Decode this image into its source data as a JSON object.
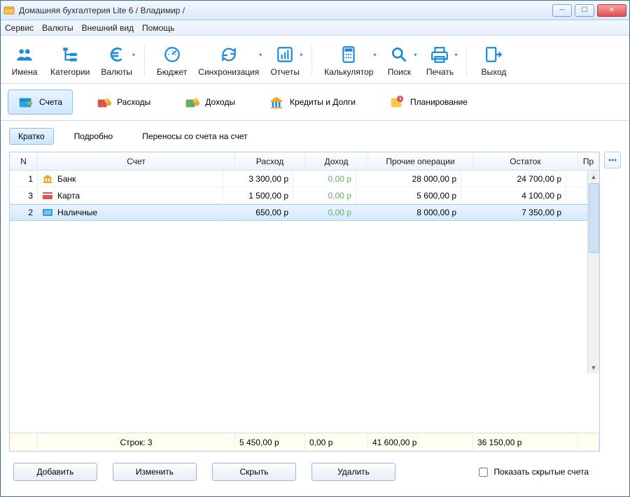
{
  "window": {
    "title": "Домашняя бухгалтерия Lite 6  / Владимир /"
  },
  "menu": {
    "service": "Сервис",
    "currencies": "Валюты",
    "view": "Внешний вид",
    "help": "Помощь"
  },
  "toolbar": {
    "names": "Имена",
    "categories": "Категории",
    "currencies": "Валюты",
    "budget": "Бюджет",
    "sync": "Синхронизация",
    "reports": "Отчеты",
    "calculator": "Калькулятор",
    "search": "Поиск",
    "print": "Печать",
    "exit": "Выход"
  },
  "sections": {
    "accounts": "Счета",
    "expenses": "Расходы",
    "income": "Доходы",
    "loans": "Кредиты и Долги",
    "planning": "Планирование"
  },
  "subtabs": {
    "brief": "Кратко",
    "detail": "Подробно",
    "transfers": "Переносы со счета на счет"
  },
  "grid": {
    "headers": {
      "n": "N",
      "account": "Счет",
      "expense": "Расход",
      "income": "Доход",
      "other": "Прочие операции",
      "balance": "Остаток",
      "pr": "Пр"
    },
    "rows": [
      {
        "n": "1",
        "icon": "bank",
        "name": "Банк",
        "expense": "3 300,00 р",
        "income": "0,00 р",
        "other": "28 000,00 р",
        "balance": "24 700,00 р"
      },
      {
        "n": "3",
        "icon": "card",
        "name": "Карта",
        "expense": "1 500,00 р",
        "income": "0,00 р",
        "other": "5 600,00 р",
        "balance": "4 100,00 р"
      },
      {
        "n": "2",
        "icon": "cash",
        "name": "Наличные",
        "expense": "650,00 р",
        "income": "0,00 р",
        "other": "8 000,00 р",
        "balance": "7 350,00 р"
      }
    ],
    "footer": {
      "label": "Строк: 3",
      "expense": "5 450,00 р",
      "income": "0,00 р",
      "other": "41 600,00 р",
      "balance": "36 150,00 р"
    }
  },
  "actions": {
    "add": "Добавить",
    "edit": "Изменить",
    "hide": "Скрыть",
    "delete": "Удалить",
    "show_hidden": "Показать скрытые счета"
  }
}
